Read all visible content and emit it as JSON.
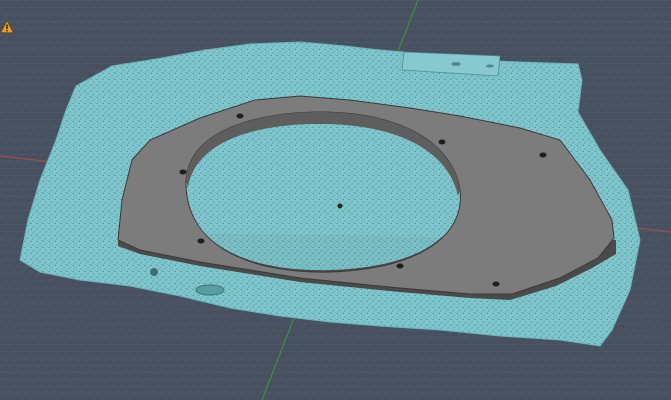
{
  "viewport": {
    "background_color": "#46505f",
    "grid_color": "#5a6474",
    "grid_major_color": "#6c7584"
  },
  "axes": {
    "x_axis_color": "#a24a4c",
    "y_axis_color": "#3f8f3f"
  },
  "scan_mesh": {
    "fill_color": "#7fc6cd",
    "speckle_color": "#4e8d96"
  },
  "speaker_adapter": {
    "top_color": "#7c7c7c",
    "rim_color": "#4a4a4a",
    "bolt_hole_color": "#1e1e1e",
    "bolt_hole_count": 7
  },
  "status": {
    "warning_icon": "warning-triangle-icon",
    "warning_color": "#f0a020"
  }
}
